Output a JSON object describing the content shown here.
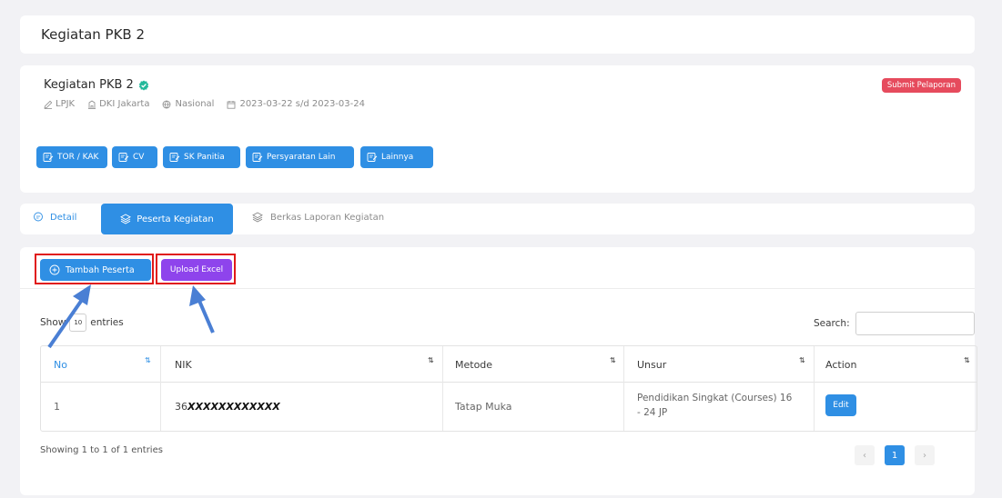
{
  "page_title": "Kegiatan PKB 2",
  "event": {
    "title": "Kegiatan PKB 2",
    "organizer": "LPJK",
    "province": "DKI Jakarta",
    "scope": "Nasional",
    "date_range": "2023-03-22 s/d 2023-03-24",
    "submit_label": "Submit Pelaporan",
    "documents": [
      "TOR / KAK",
      "CV",
      "SK Panitia",
      "Persyaratan Lain",
      "Lainnya"
    ]
  },
  "tabs": [
    "Detail",
    "Peserta Kegiatan",
    "Berkas Laporan Kegiatan"
  ],
  "toolbar": {
    "add_label": "Tambah Peserta",
    "upload_label": "Upload Excel"
  },
  "table_controls": {
    "show_prefix": "Show",
    "page_size": "10",
    "show_suffix": "entries",
    "search_label": "Search:",
    "search_value": ""
  },
  "table": {
    "columns": [
      "No",
      "NIK",
      "Metode",
      "Unsur",
      "Action"
    ],
    "rows": [
      {
        "no": "1",
        "nik_prefix": "36",
        "nik_masked": "XXXXXXXXXXXX",
        "metode": "Tatap Muka",
        "unsur": "Pendidikan Singkat (Courses) 16 - 24 JP",
        "action": "Edit"
      }
    ]
  },
  "footer": {
    "info": "Showing 1 to 1 of 1 entries",
    "current_page": "1"
  },
  "colors": {
    "primary": "#2f8fe4",
    "purple": "#8e44ec",
    "red": "#e64b5d",
    "highlight": "#e01919",
    "arrow": "#4a7fd4"
  }
}
